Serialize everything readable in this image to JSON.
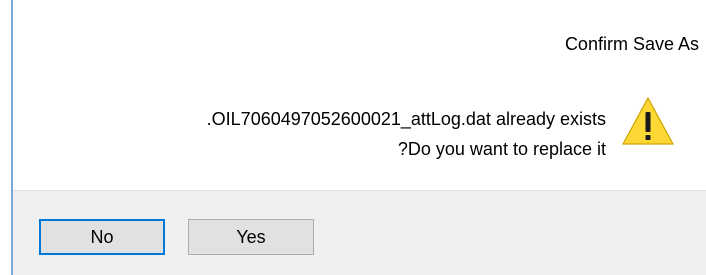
{
  "dialog": {
    "title": "Confirm Save As",
    "message_line_1": ".OIL7060497052600021_attLog.dat already exists",
    "message_line_2": "?Do you want to replace it",
    "icon": "warning-icon",
    "icon_color": "#fdd835"
  },
  "buttons": {
    "no_label": "No",
    "yes_label": "Yes",
    "default_button": "No",
    "default_border_color": "#0078d7"
  }
}
